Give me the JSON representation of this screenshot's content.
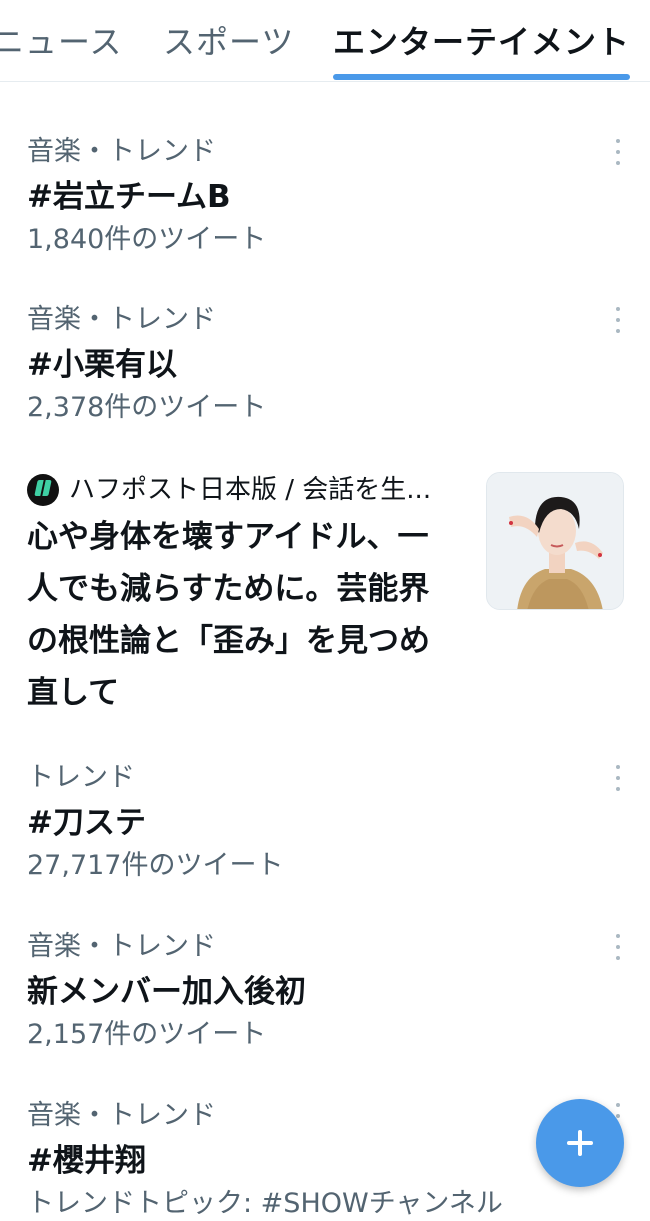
{
  "tabs": [
    {
      "label": "ニュース"
    },
    {
      "label": "スポーツ"
    },
    {
      "label": "エンターテイメント",
      "active": true
    }
  ],
  "trends": [
    {
      "category": "音楽・トレンド",
      "title": "#岩立チームB",
      "count": "1,840件のツイート"
    },
    {
      "category": "音楽・トレンド",
      "title": "#小栗有以",
      "count": "2,378件のツイート"
    },
    {
      "category": "トレンド",
      "title": "#刀ステ",
      "count": "27,717件のツイート"
    },
    {
      "category": "音楽・トレンド",
      "title": "新メンバー加入後初",
      "count": "2,157件のツイート"
    },
    {
      "category": "音楽・トレンド",
      "title": "#櫻井翔",
      "count": "トレンドトピック: #SHOWチャンネル"
    }
  ],
  "news": {
    "source": "ハフポスト日本版 / 会話を生...",
    "headline": "心や身体を壊すアイドル、一人でも減らすために。芸能界の根性論と「歪み」を見つめ直して"
  },
  "colors": {
    "accent": "#4a99e9",
    "text_primary": "#0f1419",
    "text_secondary": "#536471"
  },
  "icons": {
    "more": "more-vertical-icon",
    "compose": "plus-icon",
    "source_logo": "huffpost-logo-icon"
  }
}
